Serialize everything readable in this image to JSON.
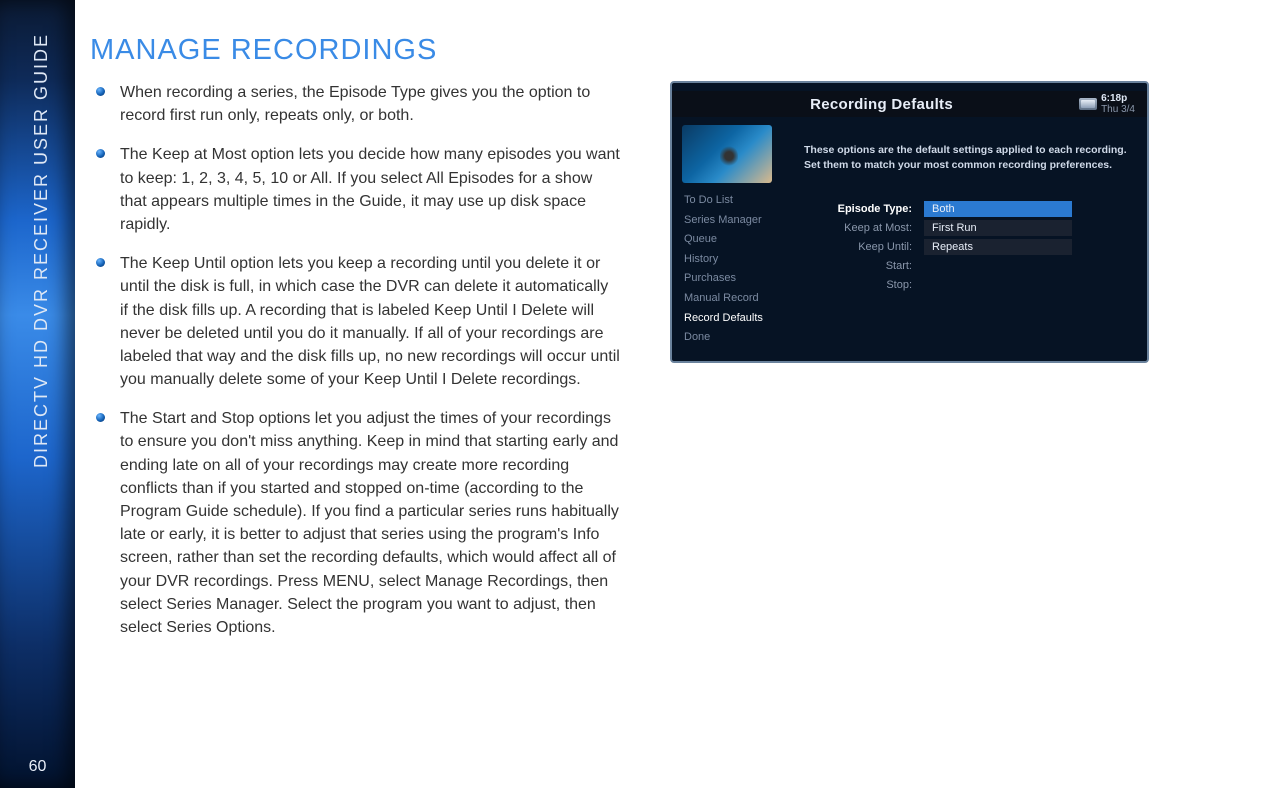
{
  "spine": {
    "label": "DIRECTV HD DVR RECEIVER USER GUIDE",
    "page_number": "60"
  },
  "heading": "MANAGE RECORDINGS",
  "bullets": [
    "When recording a series, the Episode Type gives you the option to record first run only, repeats only, or both.",
    "The Keep at Most option lets you decide how many episodes you want to keep: 1, 2, 3, 4, 5, 10 or All. If you select All Episodes for a show that appears multiple times in the Guide, it may use up disk space rapidly.",
    "The Keep Until option lets you keep a recording until you delete it or until the disk is full, in which case the DVR can delete it automatically if the disk fills up. A recording that is labeled Keep Until I Delete will never be deleted until you do it manually. If all of your recordings are labeled that way and the disk fills up, no new recordings will occur until you manually delete some of your Keep Until I Delete recordings.",
    "The Start and Stop options let you adjust the times of your recordings to ensure you don't miss anything. Keep in mind that starting early and ending late on all of your recordings may create more recording conflicts than if you started and stopped on-time (according to the Program Guide schedule). If you find a particular series runs habitually late or early, it is better to adjust that series using the program's Info screen, rather than set the recording defaults, which would affect all of your DVR recordings. Press MENU, select Manage Recordings, then select Series Manager. Select the program you want to adjust, then select Series Options."
  ],
  "screenshot": {
    "banner_title": "Recording Defaults",
    "clock_time": "6:18p",
    "clock_date": "Thu 3/4",
    "description": "These options are the default settings applied to each recording. Set them to match your most common recording preferences.",
    "menu": [
      {
        "label": "To Do List",
        "active": false
      },
      {
        "label": "Series Manager",
        "active": false
      },
      {
        "label": "Queue",
        "active": false
      },
      {
        "label": "History",
        "active": false
      },
      {
        "label": "Purchases",
        "active": false
      },
      {
        "label": "Manual Record",
        "active": false
      },
      {
        "label": "Record Defaults",
        "active": true
      },
      {
        "label": "Done",
        "active": false
      }
    ],
    "form": {
      "episode_type": {
        "label": "Episode Type:",
        "value": "Both"
      },
      "keep_at_most": {
        "label": "Keep at Most:",
        "value": "First Run"
      },
      "keep_until": {
        "label": "Keep Until:",
        "value": "Repeats"
      },
      "start": {
        "label": "Start:",
        "value": ""
      },
      "stop": {
        "label": "Stop:",
        "value": ""
      }
    }
  }
}
